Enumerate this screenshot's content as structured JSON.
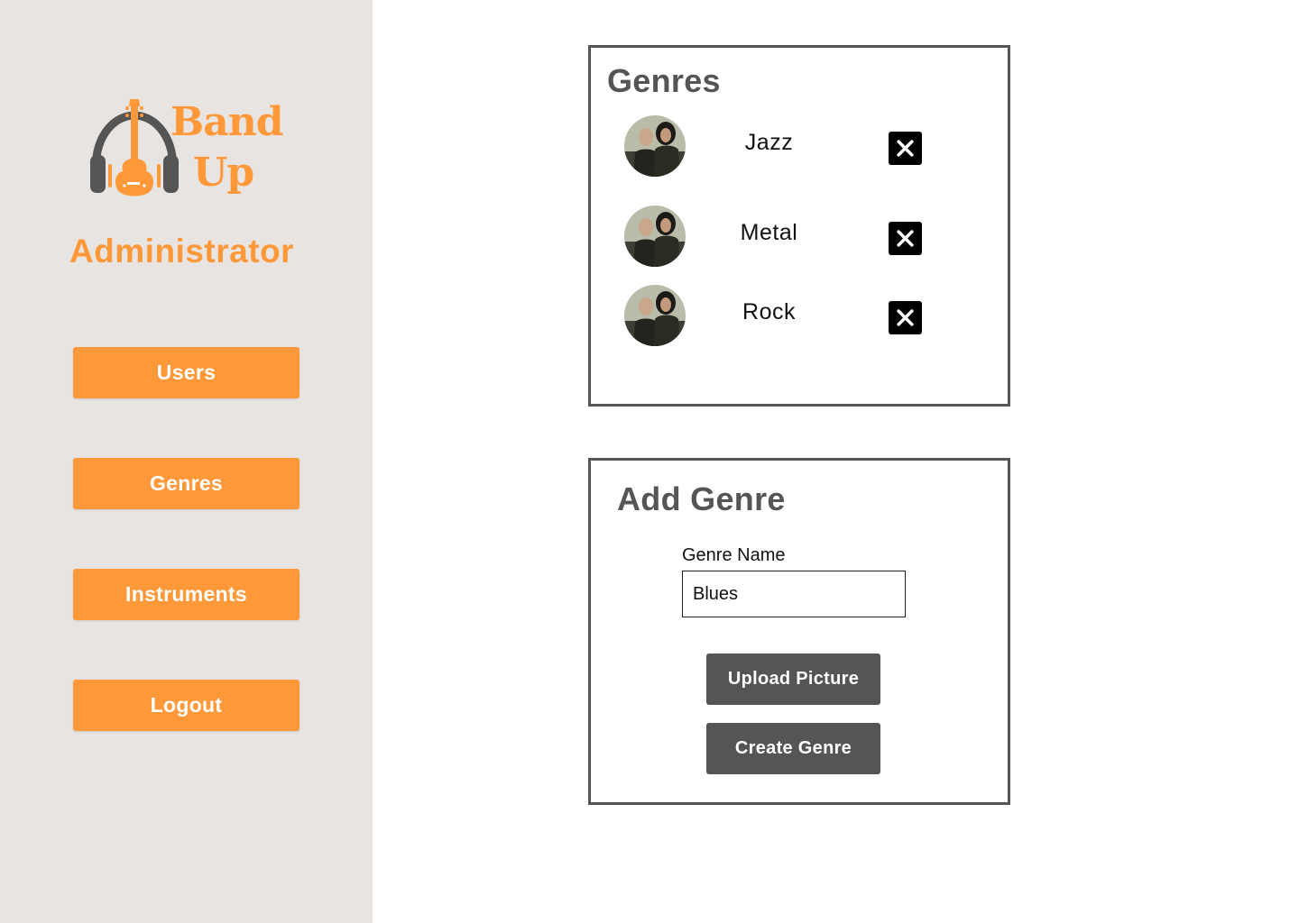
{
  "brand": {
    "name_line1": "Band",
    "name_line2": "Up",
    "color": "#ff9838",
    "icon": "guitar-headphones-icon"
  },
  "sidebar": {
    "role_title": "Administrator",
    "nav": [
      {
        "label": "Users"
      },
      {
        "label": "Genres"
      },
      {
        "label": "Instruments"
      },
      {
        "label": "Logout"
      }
    ]
  },
  "genres_panel": {
    "title": "Genres",
    "items": [
      {
        "name": "Jazz",
        "avatar": "band-photo",
        "delete_icon": "close-icon"
      },
      {
        "name": "Metal",
        "avatar": "band-photo",
        "delete_icon": "close-icon"
      },
      {
        "name": "Rock",
        "avatar": "band-photo",
        "delete_icon": "close-icon"
      }
    ]
  },
  "add_genre_panel": {
    "title": "Add Genre",
    "field_label": "Genre Name",
    "field_value": "Blues",
    "upload_label": "Upload Picture",
    "create_label": "Create Genre"
  },
  "colors": {
    "accent": "#ff9838",
    "sidebar_bg": "#e8e4e2",
    "dark_button": "#555555",
    "panel_border": "#555555"
  }
}
